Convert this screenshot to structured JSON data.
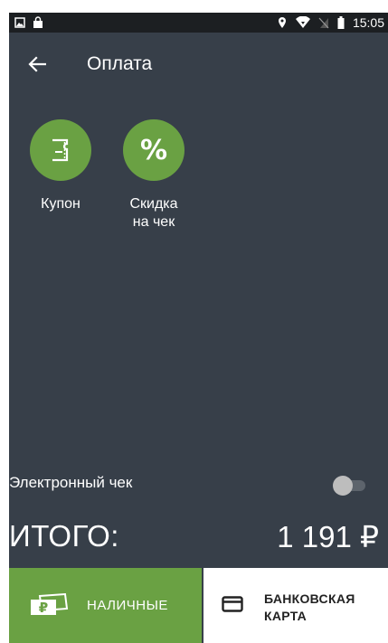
{
  "status_bar": {
    "time": "15:05",
    "left_icons": [
      "image-icon",
      "shopping-bag-icon"
    ],
    "right_icons": [
      "location-icon",
      "wifi-icon",
      "no-sim-icon",
      "battery-icon"
    ]
  },
  "app_bar": {
    "back_icon": "arrow-left-icon",
    "title": "Оплата"
  },
  "actions": {
    "coupon": {
      "label": "Купон",
      "icon": "coupon-icon"
    },
    "discount": {
      "label": "Скидка\nна чек",
      "icon": "percent-icon",
      "symbol": "%"
    }
  },
  "ereceipt": {
    "label": "Электронный чек",
    "enabled": false
  },
  "total": {
    "label": "ИТОГО:",
    "amount": "1 191 ₽"
  },
  "payment": {
    "cash_label": "НАЛИЧНЫЕ",
    "card_label": "БАНКОВСКАЯ\nКАРТА"
  },
  "colors": {
    "background": "#373f49",
    "accent_green": "#6aa143",
    "status_bar": "#1c1f22",
    "card_button": "#ffffff"
  }
}
